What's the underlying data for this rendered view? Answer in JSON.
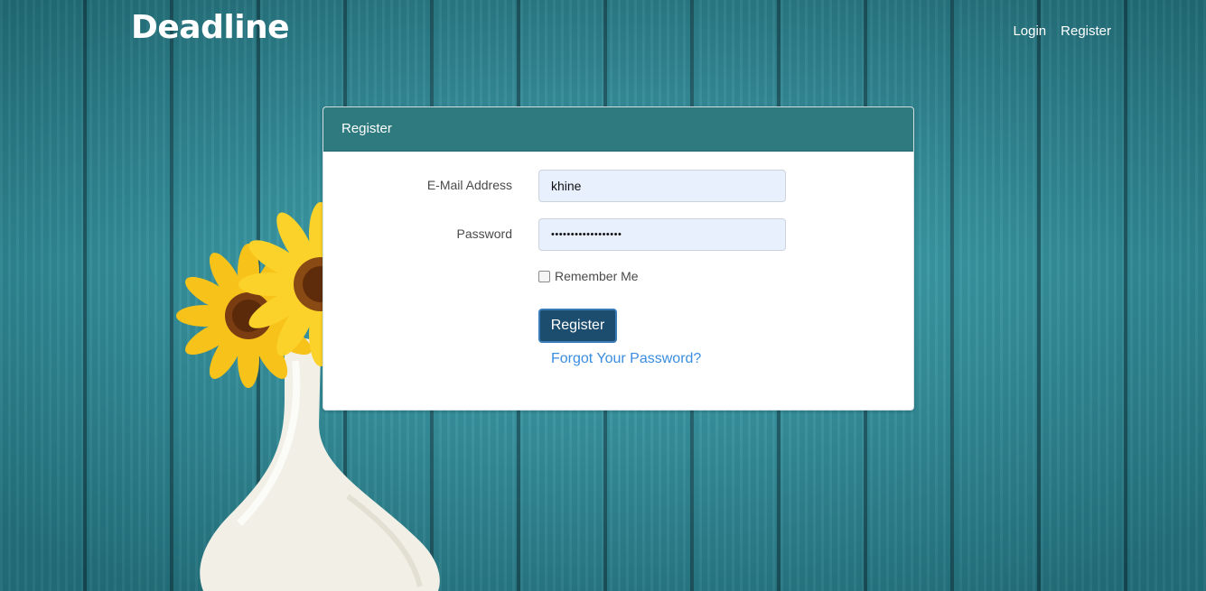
{
  "app": {
    "brand": "Deadline"
  },
  "nav": {
    "login": "Login",
    "register": "Register"
  },
  "panel": {
    "title": "Register",
    "email": {
      "label": "E-Mail Address",
      "value": "khine"
    },
    "password": {
      "label": "Password",
      "value": "••••••••••••••••••"
    },
    "remember": {
      "label": "Remember Me",
      "checked": false
    },
    "submit_label": "Register",
    "forgot_label": "Forgot Your Password?"
  },
  "colors": {
    "panel_header": "#2e7a7f",
    "button": "#1d4d6e",
    "link": "#3a8de0",
    "input_bg": "#e8f0fe"
  }
}
